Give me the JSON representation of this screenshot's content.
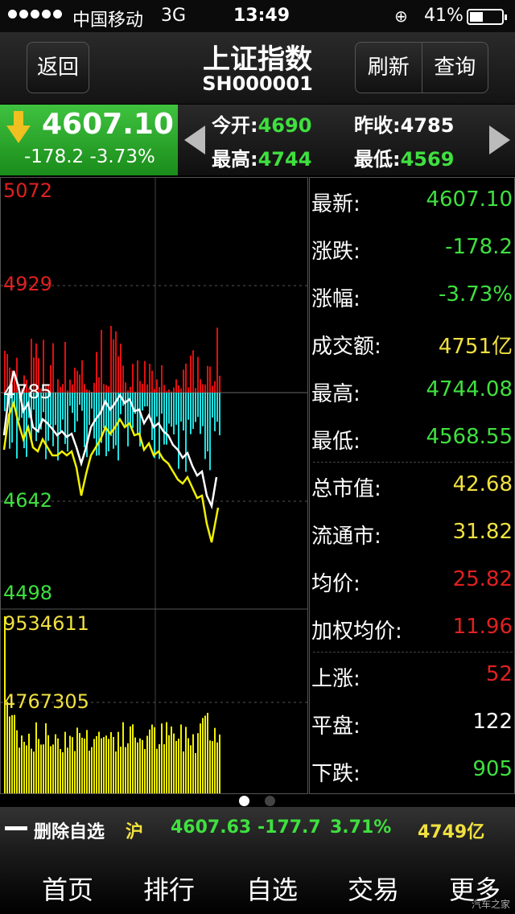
{
  "status_bar": {
    "carrier": "中国移动",
    "network": "3G",
    "time": "13:49",
    "battery": "41%"
  },
  "nav": {
    "back_label": "返回",
    "title": "上证指数",
    "code": "SH000001",
    "refresh_label": "刷新",
    "query_label": "查询"
  },
  "price": {
    "current": "4607.10",
    "change": "-178.2",
    "change_pct": "-3.73%"
  },
  "quotes": {
    "open_label": "今开:",
    "open": "4690",
    "prev_label": "昨收:",
    "prev": "4785",
    "high_label": "最高:",
    "high": "4744",
    "low_label": "最低:",
    "low": "4569"
  },
  "chart_labels": {
    "p_max": "5072",
    "p_upper": "4929",
    "p_mid": "4785",
    "p_lower": "4642",
    "p_min": "4498",
    "vol_max": "9534611",
    "vol_mid": "4767305"
  },
  "info": [
    {
      "label": "最新:",
      "value": "4607.10",
      "color": "#3fe03f"
    },
    {
      "label": "涨跌:",
      "value": "-178.2",
      "color": "#3fe03f"
    },
    {
      "label": "涨幅:",
      "value": "-3.73%",
      "color": "#3fe03f"
    },
    {
      "label": "成交额:",
      "value": "4751亿",
      "color": "#f0e040"
    },
    {
      "label": "最高:",
      "value": "4744.08",
      "color": "#3fe03f"
    },
    {
      "label": "最低:",
      "value": "4568.55",
      "color": "#3fe03f"
    },
    {
      "label": "总市值:",
      "value": "42.68",
      "color": "#f0e040"
    },
    {
      "label": "流通市:",
      "value": "31.82",
      "color": "#f0e040"
    },
    {
      "label": "均价:",
      "value": "25.82",
      "color": "#e02020"
    },
    {
      "label": "加权均价:",
      "value": "11.96",
      "color": "#e02020"
    },
    {
      "label": "上涨:",
      "value": "52",
      "color": "#e02020"
    },
    {
      "label": "平盘:",
      "value": "122",
      "color": "#ffffff"
    },
    {
      "label": "下跌:",
      "value": "905",
      "color": "#3fe03f"
    }
  ],
  "strip": {
    "delete_label": "删除自选",
    "market": "沪",
    "price": "4607.63",
    "change": "-177.7",
    "change_pct": "3.71%",
    "amount": "4749亿"
  },
  "tabs": [
    "首页",
    "排行",
    "自选",
    "交易",
    "更多"
  ],
  "watermark": "汽车之家"
}
